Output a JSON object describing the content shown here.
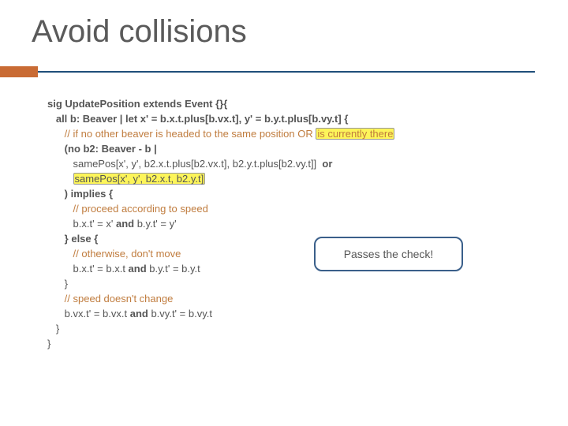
{
  "title": "Avoid collisions",
  "code": {
    "l1": "sig UpdatePosition extends Event {}{",
    "l2": "   all b: Beaver | let x' = b.x.t.plus[b.vx.t], y' = b.y.t.plus[b.vy.t] {",
    "l3_pre": "      ",
    "l3_cm": "// if no other beaver is headed to the same position OR ",
    "l3_hl": "is currently there",
    "l4": "      (no b2: Beaver - b |",
    "l5_pre": "         samePos[x', y', b2.x.t.plus[b2.vx.t], b2.y.t.plus[b2.vy.t]]",
    "l5_or": "  or",
    "l6_pre": "         ",
    "l6_hl": "samePos[x', y', b2.x.t, b2.y.t]",
    "l7": "      ) implies {",
    "l8_pre": "         ",
    "l8_cm": "// proceed according to speed",
    "l9a": "         b.x.t' = x' ",
    "l9and": "and",
    "l9b": " b.y.t' = y'",
    "l10": "      } else {",
    "l11_pre": "         ",
    "l11_cm": "// otherwise, don't move",
    "l12a": "         b.x.t' = b.x.t ",
    "l12and": "and",
    "l12b": " b.y.t' = b.y.t",
    "l13": "      }",
    "l14_pre": "      ",
    "l14_cm": "// speed doesn't change",
    "l15a": "      b.vx.t' = b.vx.t ",
    "l15and": "and",
    "l15b": " b.vy.t' = b.vy.t",
    "l16": "   }",
    "l17": "}"
  },
  "callout": "Passes the check!"
}
